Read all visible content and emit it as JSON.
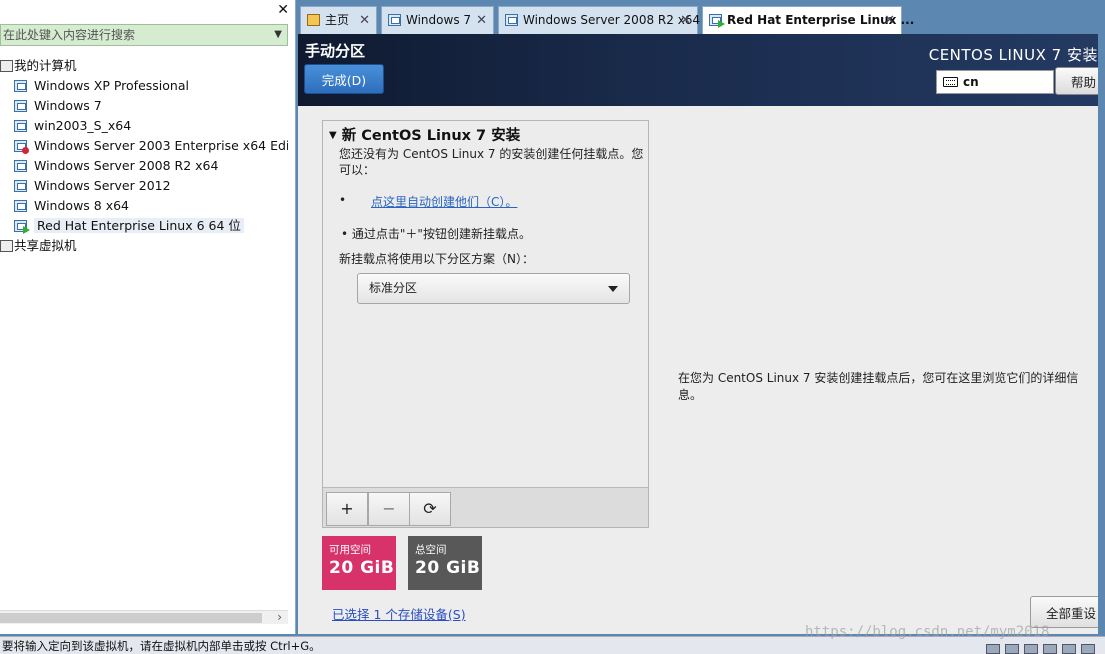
{
  "library": {
    "close_glyph": "✕",
    "search_placeholder": "在此处键入内容进行搜索",
    "tree": {
      "root_label": "我的计算机",
      "vms": [
        {
          "label": "Windows XP Professional",
          "state": "normal"
        },
        {
          "label": "Windows 7",
          "state": "normal"
        },
        {
          "label": "win2003_S_x64",
          "state": "normal"
        },
        {
          "label": "Windows Server 2003 Enterprise x64 Edition",
          "state": "error"
        },
        {
          "label": "Windows Server 2008 R2 x64",
          "state": "normal"
        },
        {
          "label": "Windows Server 2012",
          "state": "normal"
        },
        {
          "label": "Windows 8 x64",
          "state": "normal"
        },
        {
          "label": "Red Hat Enterprise Linux 6 64 位",
          "state": "running",
          "selected": true
        }
      ],
      "shared_label": "共享虚拟机"
    }
  },
  "tabs": [
    {
      "label": "主页",
      "icon": "home-icon"
    },
    {
      "label": "Windows 7",
      "icon": "vm-icon"
    },
    {
      "label": "Windows Server 2008 R2 x64",
      "icon": "vm-icon"
    },
    {
      "label": "Red Hat Enterprise Linux ...",
      "icon": "vm-running-icon",
      "active": true
    }
  ],
  "installer": {
    "page_title": "手动分区",
    "done_button": "完成(D)",
    "product_title": "CENTOS LINUX 7 安装",
    "keyboard_layout": "cn",
    "help_button": "帮助",
    "section_heading": "新 CentOS Linux 7 安装",
    "no_mount_msg": "您还没有为 CentOS Linux 7 的安装创建任何挂载点。您可以：",
    "auto_create_link": "点这里自动创建他们（C）。",
    "manual_hint": "通过点击\"＋\"按钮创建新挂载点。",
    "scheme_label": "新挂载点将使用以下分区方案（N）：",
    "scheme_value": "标准分区",
    "toolbar": {
      "add": "+",
      "remove": "−",
      "refresh": "⟳"
    },
    "available_space": {
      "caption": "可用空间",
      "value": "20 GiB"
    },
    "total_space": {
      "caption": "总空间",
      "value": "20 GiB"
    },
    "storage_link": "已选择 1 个存储设备(S)",
    "detail_msg": "在您为 CentOS Linux 7 安装创建挂载点后，您可在这里浏览它们的详细信息。",
    "reset_button": "全部重设"
  },
  "status_bar": {
    "text": "要将输入定向到该虚拟机，请在虚拟机内部单击或按 Ctrl+G。"
  },
  "watermark": "https://blog.csdn.net/mym2018"
}
